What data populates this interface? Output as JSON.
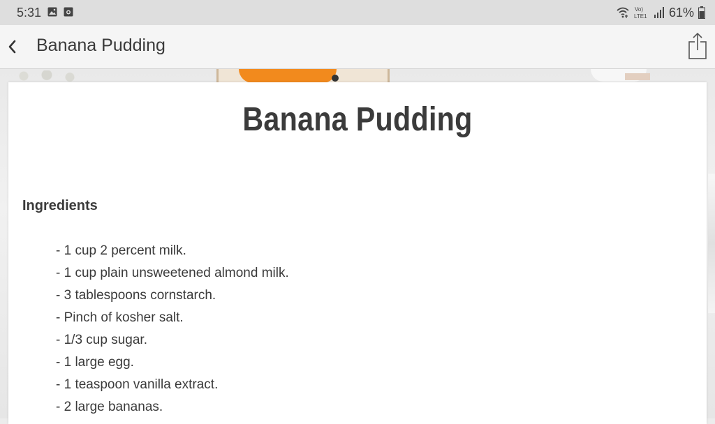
{
  "status_bar": {
    "time": "5:31",
    "icons_left": [
      "image-icon",
      "camera-icon"
    ],
    "network": "VoLTE1",
    "battery": "61%"
  },
  "app_bar": {
    "title": "Banana Pudding",
    "back_icon": "chevron-left-icon",
    "share_icon": "share-icon"
  },
  "recipe": {
    "title": "Banana Pudding",
    "ingredients_heading": "Ingredients",
    "ingredients": [
      "- 1 cup 2 percent milk.",
      "- 1 cup plain unsweetened almond milk.",
      "- 3 tablespoons cornstarch.",
      "- Pinch of kosher salt.",
      "- 1/3 cup sugar.",
      "- 1 large egg.",
      "- 1 teaspoon vanilla extract.",
      "- 2 large bananas."
    ]
  },
  "colors": {
    "status_bar_bg": "#dedede",
    "app_bar_bg": "#f5f5f5",
    "text": "#3a3a3a",
    "card_bg": "#ffffff"
  }
}
